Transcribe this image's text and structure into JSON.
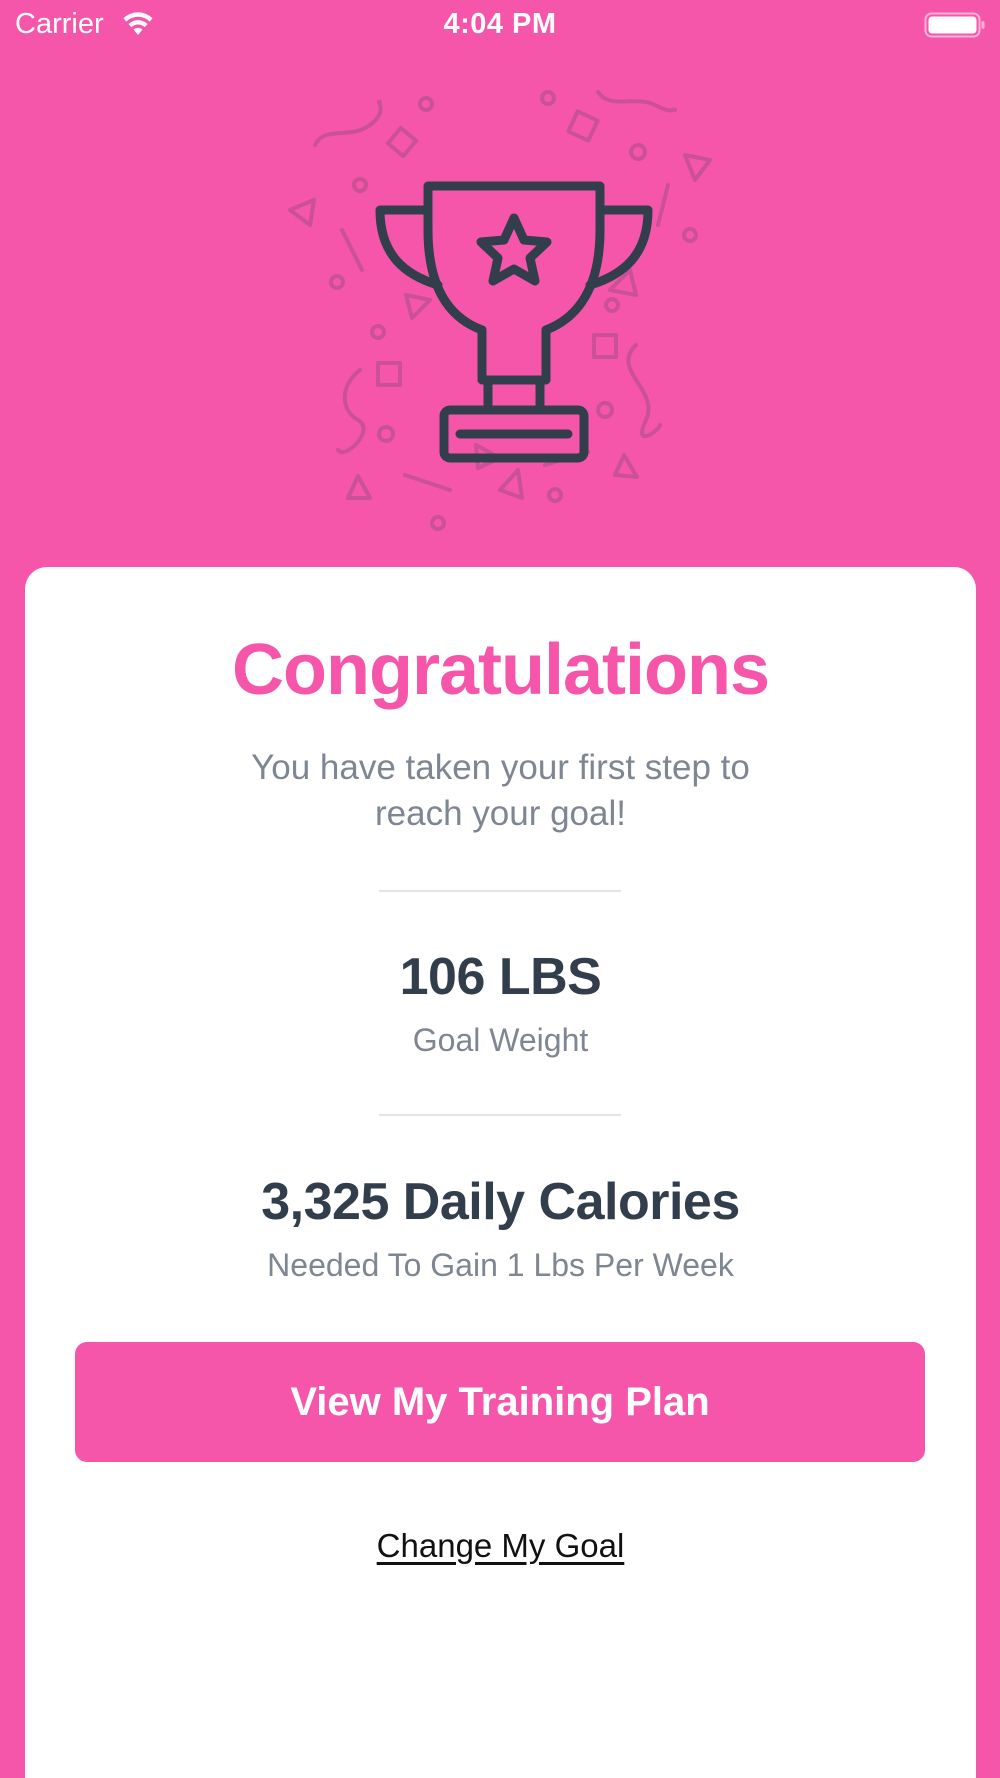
{
  "status_bar": {
    "carrier": "Carrier",
    "time": "4:04 PM",
    "wifi_icon": "wifi-icon",
    "battery_icon": "battery-icon"
  },
  "hero": {
    "icon": "trophy-icon",
    "decoration": "confetti"
  },
  "card": {
    "title": "Congratulations",
    "subtitle_line1": "You have taken your first step to",
    "subtitle_line2": "reach your goal!",
    "goal_weight": {
      "value": "106 LBS",
      "label": "Goal Weight"
    },
    "calories": {
      "value": "3,325 Daily Calories",
      "label": "Needed To Gain 1 Lbs Per Week"
    },
    "primary_button": "View My Training Plan",
    "secondary_link": "Change My Goal"
  },
  "colors": {
    "background": "#F556AA",
    "accent": "#F556AA",
    "card": "#FFFFFF",
    "heading_dark": "#333E4C",
    "muted_text": "#7D8691",
    "icon_stroke": "#333E4C"
  }
}
